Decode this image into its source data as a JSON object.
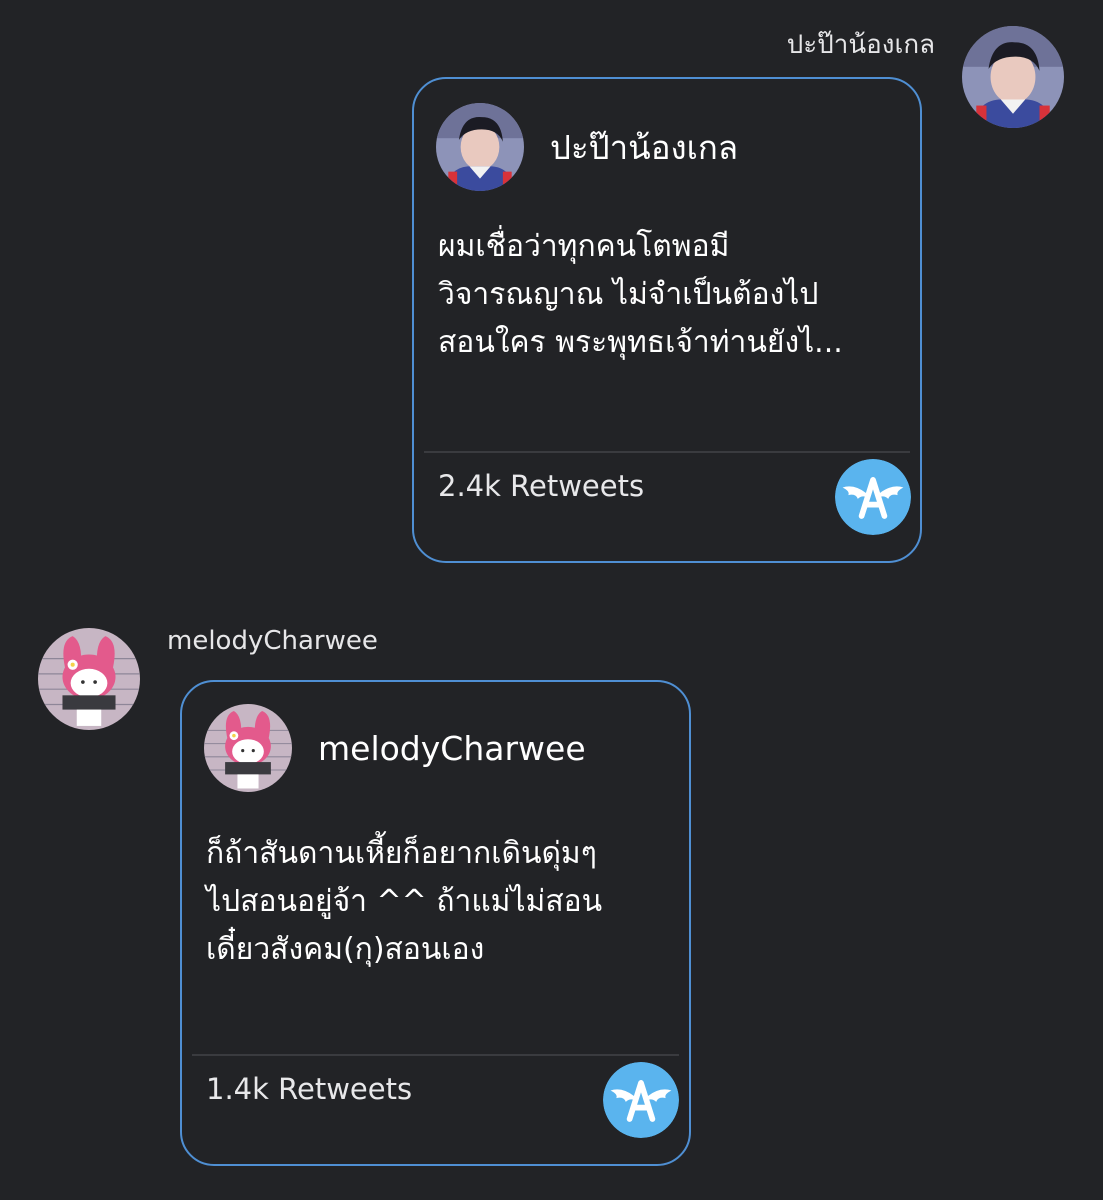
{
  "messages": [
    {
      "sender": "ปะป๊าน้องเกล",
      "card": {
        "author": "ปะป๊าน้องเกล",
        "lines": [
          "ผมเชื่อว่าทุกคนโตพอมี",
          "วิจารณญาณ ไม่จำเป็นต้องไป",
          "สอนใคร พระพุทธเจ้าท่านยังไ..."
        ],
        "retweets": "2.4k Retweets",
        "badge_icon": "winged-a-app-icon"
      }
    },
    {
      "sender": "melodyCharwee",
      "card": {
        "author": "melodyCharwee",
        "lines": [
          "ก็ถ้าสันดานเหี้ยก็อยากเดินดุ่มๆ",
          "ไปสอนอยู่จ้า ^^ ถ้าแม่ไม่สอน",
          "เดี๋ยวสังคม(กุ)สอนเอง"
        ],
        "retweets": "1.4k Retweets",
        "badge_icon": "winged-a-app-icon"
      }
    }
  ],
  "colors": {
    "background": "#222326",
    "card_border": "#4f8fd3",
    "badge": "#5ab4ee"
  }
}
